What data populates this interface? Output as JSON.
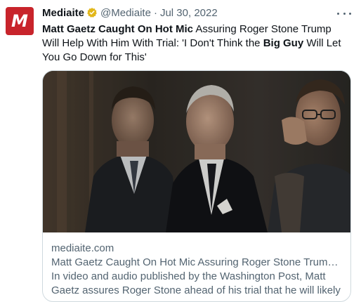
{
  "tweet": {
    "author_name": "Mediaite",
    "handle": "@Mediaite",
    "separator": "·",
    "date": "Jul 30, 2022",
    "text_parts": {
      "p1": "Matt Gaetz Caught On Hot Mic",
      "p2": " Assuring Roger Stone Trump Will Help With Him With Trial: 'I Don't Think the ",
      "p3": "Big Guy",
      "p4": " Will Let You Go Down for This'"
    }
  },
  "card": {
    "domain": "mediaite.com",
    "title": "Matt Gaetz Caught On Hot Mic Assuring Roger Stone Trump Will Hel...",
    "description": "In video and audio published by the Washington Post, Matt Gaetz assures Roger Stone ahead of his trial that he will likely be saved by ..."
  },
  "avatar_letter": "M",
  "colors": {
    "brand_red": "#c8242b",
    "verified_gold": "#e2b719",
    "muted_text": "#536471",
    "border": "#cfd9de"
  },
  "icons": {
    "verified": "verified-badge-icon",
    "more": "more-options-icon"
  }
}
